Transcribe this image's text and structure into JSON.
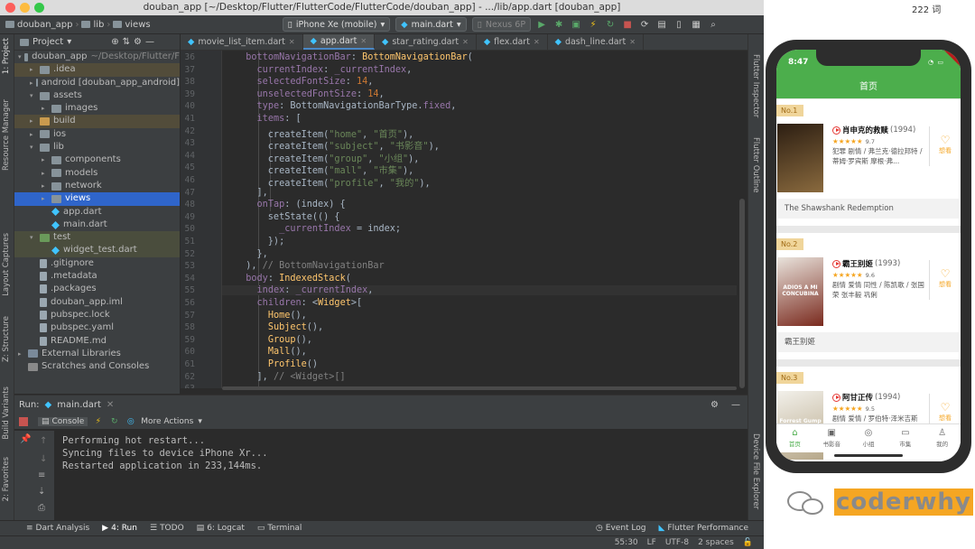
{
  "window": {
    "title": "douban_app [~/Desktop/Flutter/FlutterCode/FlutterCode/douban_app] - .../lib/app.dart [douban_app]"
  },
  "word_count": "222 词",
  "toolbar": {
    "crumbs": [
      "douban_app",
      "lib",
      "views"
    ],
    "device": "iPhone Xe (mobile)",
    "run_config": "main.dart",
    "device2": "Nexus 6P"
  },
  "left_strip": [
    "1: Project",
    "Resource Manager",
    "Layout Captures",
    "Z: Structure",
    "Build Variants",
    "2: Favorites"
  ],
  "right_strip": [
    "Flutter Inspector",
    "Flutter Outline",
    "Device File Explorer"
  ],
  "project": {
    "label": "Project",
    "rows": [
      {
        "depth": 0,
        "arrow": "▾",
        "icon": "folder",
        "name": "douban_app",
        "extra": "~/Desktop/Flutter/F"
      },
      {
        "depth": 1,
        "arrow": "▸",
        "icon": "folder",
        "name": ".idea",
        "cls": "ex"
      },
      {
        "depth": 1,
        "arrow": "▸",
        "icon": "folder",
        "name": "android [douban_app_android]"
      },
      {
        "depth": 1,
        "arrow": "▾",
        "icon": "folder",
        "name": "assets"
      },
      {
        "depth": 2,
        "arrow": "▸",
        "icon": "folder",
        "name": "images"
      },
      {
        "depth": 1,
        "arrow": "▸",
        "icon": "folder-orange",
        "name": "build",
        "cls": "ex"
      },
      {
        "depth": 1,
        "arrow": "▸",
        "icon": "folder",
        "name": "ios"
      },
      {
        "depth": 1,
        "arrow": "▾",
        "icon": "folder",
        "name": "lib"
      },
      {
        "depth": 2,
        "arrow": "▸",
        "icon": "folder",
        "name": "components"
      },
      {
        "depth": 2,
        "arrow": "▸",
        "icon": "folder",
        "name": "models"
      },
      {
        "depth": 2,
        "arrow": "▸",
        "icon": "folder",
        "name": "network"
      },
      {
        "depth": 2,
        "arrow": "▸",
        "icon": "folder",
        "name": "views",
        "cls": "sel"
      },
      {
        "depth": 2,
        "arrow": "",
        "icon": "dart",
        "name": "app.dart"
      },
      {
        "depth": 2,
        "arrow": "",
        "icon": "dart",
        "name": "main.dart"
      },
      {
        "depth": 1,
        "arrow": "▾",
        "icon": "folder-green",
        "name": "test",
        "cls": "hi"
      },
      {
        "depth": 2,
        "arrow": "",
        "icon": "dart",
        "name": "widget_test.dart",
        "cls": "hi"
      },
      {
        "depth": 1,
        "arrow": "",
        "icon": "file",
        "name": ".gitignore"
      },
      {
        "depth": 1,
        "arrow": "",
        "icon": "file",
        "name": ".metadata"
      },
      {
        "depth": 1,
        "arrow": "",
        "icon": "file",
        "name": ".packages"
      },
      {
        "depth": 1,
        "arrow": "",
        "icon": "file",
        "name": "douban_app.iml"
      },
      {
        "depth": 1,
        "arrow": "",
        "icon": "file",
        "name": "pubspec.lock"
      },
      {
        "depth": 1,
        "arrow": "",
        "icon": "file",
        "name": "pubspec.yaml"
      },
      {
        "depth": 1,
        "arrow": "",
        "icon": "file",
        "name": "README.md"
      },
      {
        "depth": 0,
        "arrow": "▸",
        "icon": "lib",
        "name": "External Libraries"
      },
      {
        "depth": 0,
        "arrow": "",
        "icon": "scratch",
        "name": "Scratches and Consoles"
      }
    ]
  },
  "tabs": [
    {
      "name": "movie_list_item.dart"
    },
    {
      "name": "app.dart",
      "active": true
    },
    {
      "name": "star_rating.dart"
    },
    {
      "name": "flex.dart"
    },
    {
      "name": "dash_line.dart"
    }
  ],
  "editor": {
    "lines": [
      {
        "n": "36",
        "h": "  <span class=\"pr\">bottomNavigationBar</span>: <span class=\"cl\">BottomNavigationBar</span>("
      },
      {
        "n": "37",
        "h": "    <span class=\"pr\">currentIndex</span>: <span class=\"pr\">_currentIndex</span>,"
      },
      {
        "n": "38",
        "h": "    <span class=\"pr\">selectedFontSize</span>: <span class=\"kw\">14</span>,"
      },
      {
        "n": "39",
        "h": "    <span class=\"pr\">unselectedFontSize</span>: <span class=\"kw\">14</span>,"
      },
      {
        "n": "40",
        "h": "    <span class=\"pr\">type</span>: BottomNavigationBarType.<span class=\"pr\">fixed</span>,"
      },
      {
        "n": "41",
        "h": "    <span class=\"pr\">items</span>: ["
      },
      {
        "n": "42",
        "h": "      createItem(<span class=\"st\">\"home\"</span>, <span class=\"st\">\"首页\"</span>),"
      },
      {
        "n": "43",
        "h": "      createItem(<span class=\"st\">\"subject\"</span>, <span class=\"st\">\"书影音\"</span>),"
      },
      {
        "n": "44",
        "h": "      createItem(<span class=\"st\">\"group\"</span>, <span class=\"st\">\"小组\"</span>),"
      },
      {
        "n": "45",
        "h": "      createItem(<span class=\"st\">\"mall\"</span>, <span class=\"st\">\"市集\"</span>),"
      },
      {
        "n": "46",
        "h": "      createItem(<span class=\"st\">\"profile\"</span>, <span class=\"st\">\"我的\"</span>),"
      },
      {
        "n": "47",
        "h": "    ],"
      },
      {
        "n": "48",
        "h": "    <span class=\"pr\">onTap</span>: (index) {"
      },
      {
        "n": "49",
        "h": "      setState(() {"
      },
      {
        "n": "50",
        "h": "        <span class=\"pr\">_currentIndex</span> = index;"
      },
      {
        "n": "51",
        "h": "      });"
      },
      {
        "n": "52",
        "h": "    },"
      },
      {
        "n": "53",
        "h": "  ), <span class=\"cm\">// BottomNavigationBar</span>"
      },
      {
        "n": "54",
        "h": "  <span class=\"pr\">body</span>: <span class=\"cl\">IndexedStack</span>("
      },
      {
        "n": "55",
        "h": "    <span class=\"pr\">index</span>: <span class=\"pr\">_currentIndex</span>,",
        "cur": true
      },
      {
        "n": "56",
        "h": "    <span class=\"pr\">children</span>: &lt;<span class=\"cl\">Widget</span>&gt;["
      },
      {
        "n": "57",
        "h": "      <span class=\"cl\">Home</span>(),"
      },
      {
        "n": "58",
        "h": "      <span class=\"cl\">Subject</span>(),"
      },
      {
        "n": "59",
        "h": "      <span class=\"cl\">Group</span>(),"
      },
      {
        "n": "60",
        "h": "      <span class=\"cl\">Mall</span>(),"
      },
      {
        "n": "61",
        "h": "      <span class=\"cl\">Profile</span>()"
      },
      {
        "n": "62",
        "h": "    ], <span class=\"cm\">// &lt;Widget&gt;[]</span>"
      },
      {
        "n": "63",
        "h": ""
      }
    ]
  },
  "run": {
    "label": "Run:",
    "config": "main.dart",
    "console_tab": "Console",
    "more_actions": "More Actions",
    "console_lines": [
      "Performing hot restart...",
      "Syncing files to device iPhone Xr...",
      "Restarted application in 233,144ms."
    ]
  },
  "bottom_tabs": [
    {
      "label": "Dart Analysis",
      "icon": "≡"
    },
    {
      "label": "4: Run",
      "icon": "▶",
      "active": true
    },
    {
      "label": "TODO",
      "icon": "☰"
    },
    {
      "label": "6: Logcat",
      "icon": "▤"
    },
    {
      "label": "Terminal",
      "icon": "▭"
    }
  ],
  "bottom_right": [
    "Event Log",
    "Flutter Performance"
  ],
  "status": {
    "pos": "55:30",
    "lf": "LF",
    "enc": "UTF-8",
    "indent": "2 spaces"
  },
  "app": {
    "time": "8:47",
    "title": "首页",
    "debug": "DEBUG",
    "movies": [
      {
        "rank": "No.1",
        "title": "肖申克的救赎",
        "year": "(1994)",
        "stars": "★★★★★",
        "score": "9.7",
        "desc": "犯罪 剧情 / 弗兰克·德拉邦特 / 蒂姆·罗宾斯 摩根·弗...",
        "want": "想看",
        "original": "The Shawshank Redemption",
        "poster": [
          "#2c1e12",
          "#8a6a3e"
        ]
      },
      {
        "rank": "No.2",
        "title": "霸王别姬",
        "year": "(1993)",
        "stars": "★★★★★",
        "score": "9.6",
        "desc": "剧情 爱情 同性 / 陈凯歌 / 张国荣 张丰毅 巩俐",
        "want": "想看",
        "original": "霸王别姬",
        "poster": [
          "#e9e3dc",
          "#7a2a1e"
        ],
        "poster_text": "ADIOS A MI CONCUBINA"
      },
      {
        "rank": "No.3",
        "title": "阿甘正传",
        "year": "(1994)",
        "stars": "★★★★★",
        "score": "9.5",
        "desc": "剧情 爱情 / 罗伯特·泽米吉斯",
        "want": "想看",
        "original": "",
        "poster": [
          "#f2f0ea",
          "#b7a88a"
        ],
        "poster_text": "Forrest Gump"
      }
    ],
    "tabbar": [
      {
        "label": "首页",
        "icon": "⌂",
        "on": true
      },
      {
        "label": "书影音",
        "icon": "▣"
      },
      {
        "label": "小组",
        "icon": "◎"
      },
      {
        "label": "市集",
        "icon": "▭"
      },
      {
        "label": "我的",
        "icon": "♙"
      }
    ]
  },
  "watermark": "coderwhy",
  "colors": {
    "accent": "#4cae4c",
    "selection": "#2f65ca",
    "star": "#f5a623"
  }
}
